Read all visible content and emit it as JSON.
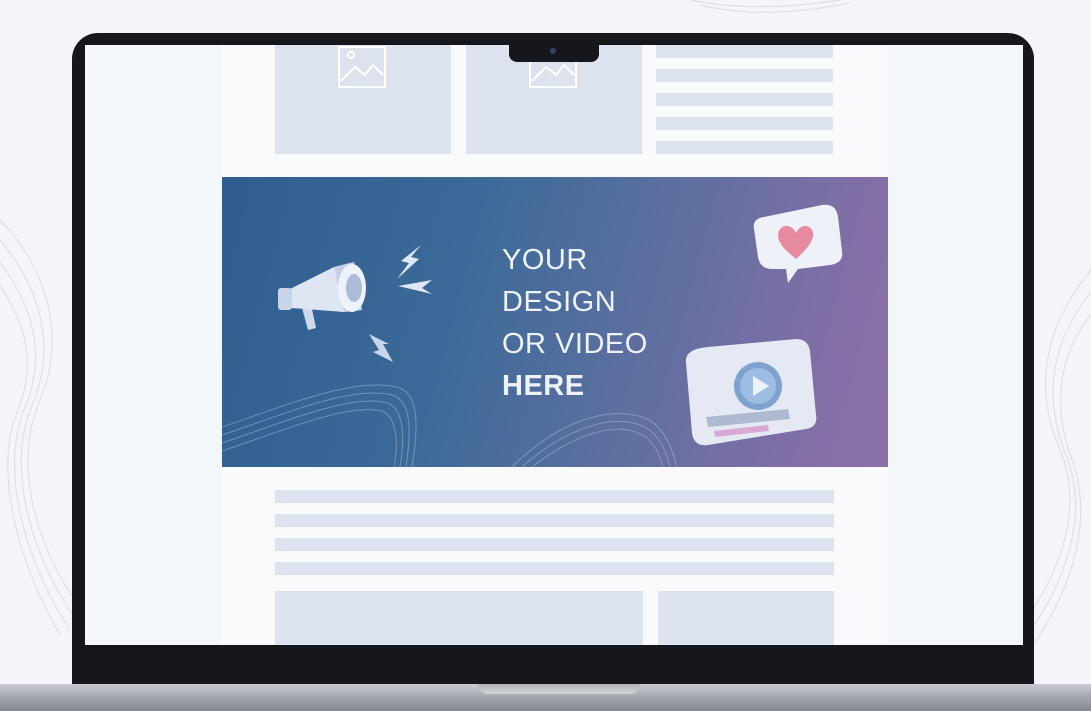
{
  "banner": {
    "line1": "YOUR",
    "line2": "DESIGN",
    "line3": "OR VIDEO",
    "line4": "HERE"
  },
  "colors": {
    "banner_start": "#2f5d8f",
    "banner_end": "#8b70a8",
    "placeholder": "#dce3ef",
    "laptop_bezel": "#15171c",
    "heart": "#e58a9f"
  },
  "icons": [
    "image-placeholder-icon",
    "megaphone-icon",
    "lightning-icon",
    "heart-speech-bubble-icon",
    "play-icon",
    "webcam-icon"
  ]
}
